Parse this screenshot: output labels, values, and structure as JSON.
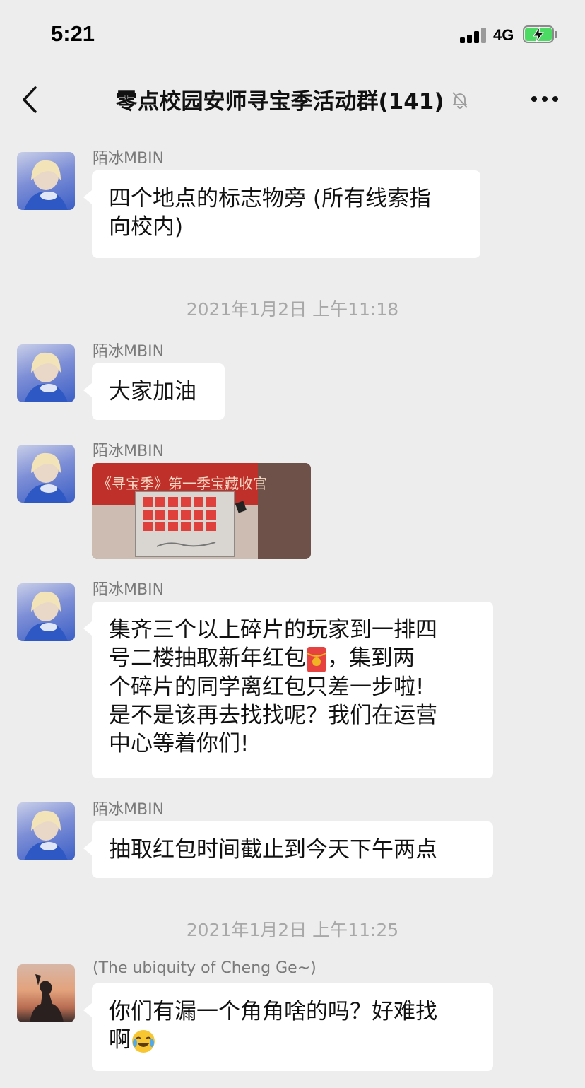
{
  "status": {
    "time": "5:21",
    "network": "4G"
  },
  "nav": {
    "title": "零点校园安师寻宝季活动群(141)"
  },
  "messages": {
    "m1": {
      "sender": "陌冰MBIN",
      "line1": "四个地点的标志物旁 (所有线索指",
      "line2": "向校内)"
    },
    "sep1": "2021年1月2日 上午11:18",
    "m2": {
      "sender": "陌冰MBIN",
      "text": "大家加油"
    },
    "m3": {
      "sender": "陌冰MBIN",
      "image_banner_text": "《寻宝季》第一季宝藏收官"
    },
    "m4": {
      "sender": "陌冰MBIN",
      "line1": "集齐三个以上碎片的玩家到一排四",
      "line2a": "号二楼抽取新年红包",
      "line2b": "，集到两",
      "line3": "个碎片的同学离红包只差一步啦!",
      "line4": "是不是该再去找找呢？我们在运营",
      "line5": "中心等着你们!"
    },
    "m5": {
      "sender": "陌冰MBIN",
      "text": "抽取红包时间截止到今天下午两点"
    },
    "sep2": "2021年1月2日 上午11:25",
    "m6": {
      "sender": "(The ubiquity of Cheng Ge~)",
      "line1": "你们有漏一个角角啥的吗？好难找",
      "line2": "啊"
    }
  },
  "colors": {
    "background": "#ededed",
    "bubble": "#ffffff",
    "battery_fill": "#4cd964",
    "red_packet": "#e64340"
  }
}
